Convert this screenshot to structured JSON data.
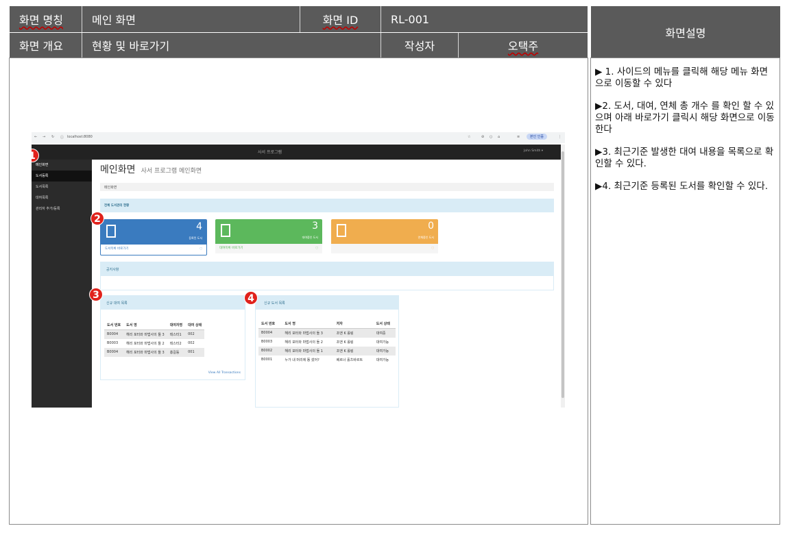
{
  "spec": {
    "screen_name_label": "화면 명칭",
    "screen_name": "메인 화면",
    "screen_id_label": "화면 ID",
    "screen_id": "RL-001",
    "overview_label": "화면 개요",
    "overview": "현황 및 바로가기",
    "author_label": "작성자",
    "author": "오택주",
    "description_title": "화면설명",
    "descriptions": [
      "▶  1. 사이드의 메뉴를 클릭해 해당 메뉴 화면으로 이동할 수 있다",
      "▶2. 도서, 대여, 연체 총 개수 를 확인 할 수 있으며 아래 바로가기 클릭시 해당 화면으로 이동한다",
      "▶3. 최근기준 발생한 대여 내용을 목록으로 확인할 수 있다.",
      "▶4. 최근기준 등록된 도서를 확인할 수 있다."
    ]
  },
  "browser": {
    "url": "localhost:8080",
    "profile": "본인 인증"
  },
  "app": {
    "topbar_title": "사서 프로그램",
    "user": "John Smith ▾",
    "sidebar": [
      "메인화면",
      "도서등록",
      "도서목록",
      "대여목록",
      "관리자 추가/등록"
    ],
    "page_title": "메인화면",
    "page_subtitle": "사서 프로그램 메인화면",
    "breadcrumb": "메인화면",
    "status_header": "전체 도서관리 현황",
    "cards": [
      {
        "count": "4",
        "label": "등록된 도서",
        "link": "도서목록 바로가기",
        "color": "#3a7bbf"
      },
      {
        "count": "3",
        "label": "대여중인 도서",
        "link": "대여목록 바로가기",
        "color": "#5cb85c"
      },
      {
        "count": "0",
        "label": "연체중인 도서",
        "link": "",
        "color": "#f0ad4e"
      }
    ],
    "notice_header": "공지사항",
    "rental_header": "신규 대여 목록",
    "rental_columns": [
      "도서 번호",
      "도서 명",
      "대여자명",
      "대여 상태"
    ],
    "rental_rows": [
      [
        "B0004",
        "해리 포터와 마법사의 돌 3",
        "테스터1",
        "002"
      ],
      [
        "B0003",
        "해리 포터와 마법사의 돌 2",
        "테스터2",
        "002"
      ],
      [
        "B0004",
        "해리 포터와 마법사의 돌 3",
        "홍길동",
        "001"
      ]
    ],
    "rental_link": "View All Transactions",
    "books_header": "신규 도서 목록",
    "books_columns": [
      "도서 번호",
      "도서 명",
      "저자",
      "도서 상태"
    ],
    "books_rows": [
      [
        "B0004",
        "해리 포터와 마법사의 돌 3",
        "조앤 K 롤링",
        "대여중"
      ],
      [
        "B0003",
        "해리 포터와 마법사의 돌 2",
        "조앤 K 롤링",
        "대여가능"
      ],
      [
        "B0002",
        "해리 포터와 마법사의 돌 1",
        "조앤 K 롤링",
        "대여가능"
      ],
      [
        "B0001",
        "누가 내 머리에 똥 쌌어?",
        "베르너 홀츠바르트",
        "대여가능"
      ]
    ],
    "markers": [
      "1",
      "2",
      "3",
      "4"
    ]
  }
}
